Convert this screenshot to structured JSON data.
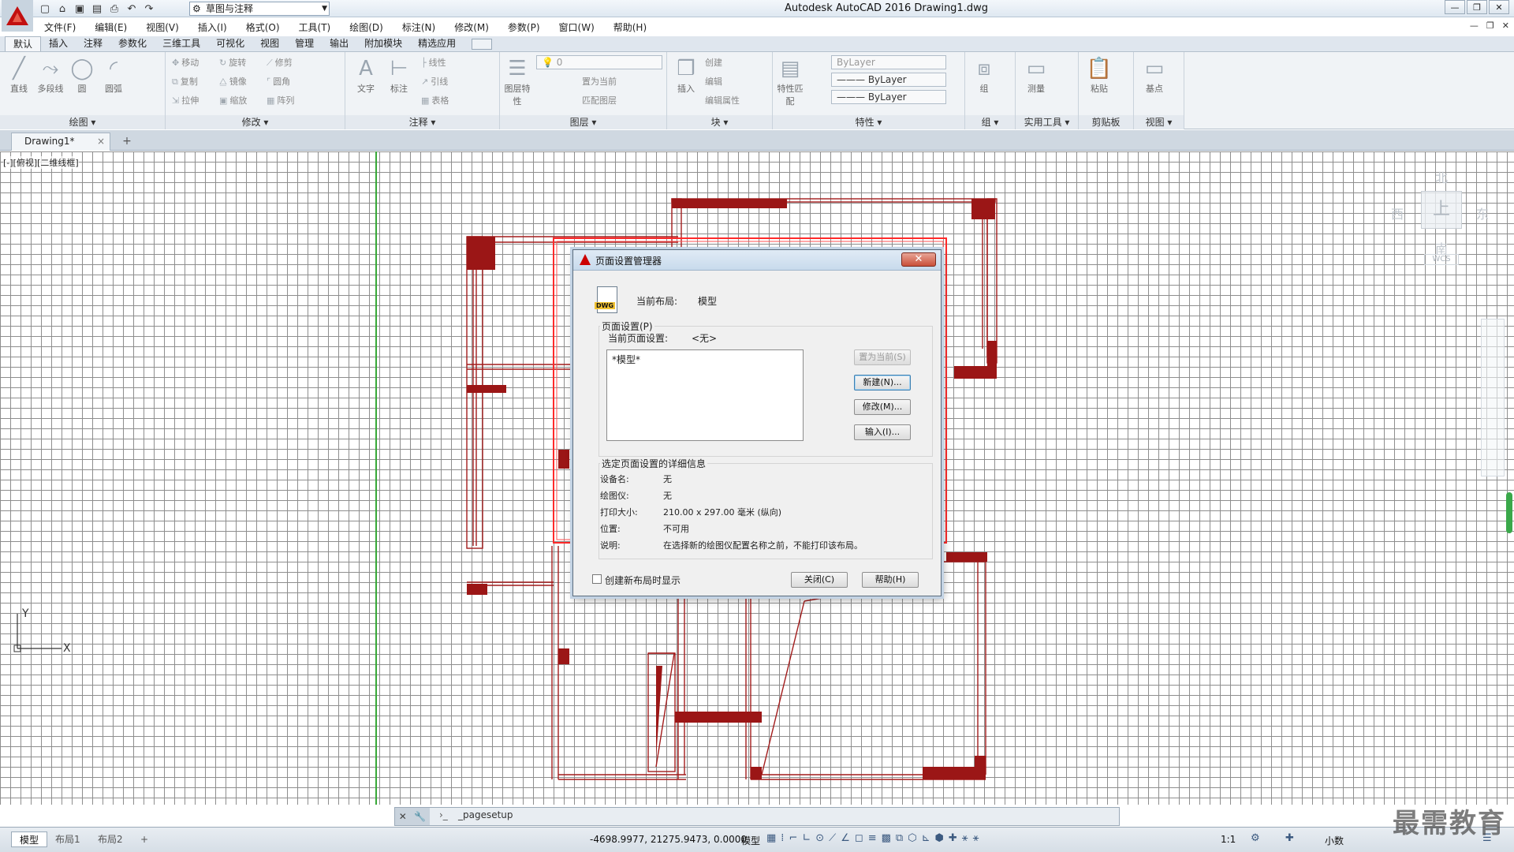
{
  "app": {
    "window_title": "Autodesk AutoCAD 2016    Drawing1.dwg",
    "workspace": "草图与注释"
  },
  "menus": [
    "文件(F)",
    "编辑(E)",
    "视图(V)",
    "插入(I)",
    "格式(O)",
    "工具(T)",
    "绘图(D)",
    "标注(N)",
    "修改(M)",
    "参数(P)",
    "窗口(W)",
    "帮助(H)"
  ],
  "ribbon_tabs": [
    "默认",
    "插入",
    "注释",
    "参数化",
    "三维工具",
    "可视化",
    "视图",
    "管理",
    "输出",
    "附加模块",
    "精选应用"
  ],
  "ribbon": {
    "draw": {
      "title": "绘图",
      "tools": [
        "直线",
        "多段线",
        "圆",
        "圆弧"
      ]
    },
    "modify": {
      "title": "修改",
      "tools": [
        "移动",
        "旋转",
        "修剪",
        "复制",
        "镜像",
        "圆角",
        "拉伸",
        "缩放",
        "阵列"
      ]
    },
    "annotation": {
      "title": "注释",
      "tools": [
        "文字",
        "标注",
        "线性",
        "引线",
        "表格"
      ]
    },
    "layers": {
      "title": "图层",
      "tools": [
        "图层特性",
        "置为当前",
        "匹配图层"
      ],
      "current_layer": "0"
    },
    "block": {
      "title": "块",
      "tools": [
        "插入",
        "创建",
        "编辑",
        "编辑属性"
      ]
    },
    "properties": {
      "title": "特性",
      "tools": [
        "特性匹配"
      ],
      "color": "ByLayer",
      "linetype": "ByLayer",
      "lineweight": "ByLayer"
    },
    "groups": {
      "title": "组",
      "tools": [
        "组"
      ]
    },
    "utilities": {
      "title": "实用工具",
      "tools": [
        "测量"
      ]
    },
    "clipboard": {
      "title": "剪贴板",
      "tools": [
        "粘贴"
      ]
    },
    "view": {
      "title": "视图",
      "tools": [
        "基点"
      ]
    }
  },
  "doc_tab": {
    "name": "Drawing1*"
  },
  "viewport_label": "[-][俯视][二维线框]",
  "viewcube": {
    "north": "北",
    "south": "南",
    "west": "西",
    "east": "东",
    "face": "上",
    "wcs": "WCS"
  },
  "ucs": {
    "x": "X",
    "y": "Y"
  },
  "command_line": {
    "prompt": "›_",
    "text": "_pagesetup"
  },
  "status": {
    "layout_tabs": [
      "模型",
      "布局1",
      "布局2"
    ],
    "coordinates": "-4698.9977, 21275.9473, 0.0000",
    "space": "模型",
    "annotation_scale": "1:1",
    "units": "小数"
  },
  "watermark": "最需教育",
  "dialog": {
    "title": "页面设置管理器",
    "current_layout_label": "当前布局:",
    "current_layout_value": "模型",
    "group_title": "页面设置(P)",
    "current_pagesetup_label": "当前页面设置:",
    "current_pagesetup_value": "<无>",
    "list_items": [
      "*模型*"
    ],
    "buttons": {
      "set_current": "置为当前(S)",
      "new": "新建(N)...",
      "modify": "修改(M)...",
      "import": "输入(I)...",
      "close": "关闭(C)",
      "help": "帮助(H)"
    },
    "details_title": "选定页面设置的详细信息",
    "details": [
      {
        "label": "设备名:",
        "value": "无"
      },
      {
        "label": "绘图仪:",
        "value": "无"
      },
      {
        "label": "打印大小:",
        "value": "210.00 x 297.00 毫米 (纵向)"
      },
      {
        "label": "位置:",
        "value": "不可用"
      },
      {
        "label": "说明:",
        "value": "在选择新的绘图仪配置名称之前，不能打印该布局。"
      }
    ],
    "checkbox_label": "创建新布局时显示",
    "checkbox_checked": false
  },
  "colors": {
    "wall": "#9b1616",
    "highlight": "#ff2a2a",
    "grid": "#8e8e8e"
  }
}
